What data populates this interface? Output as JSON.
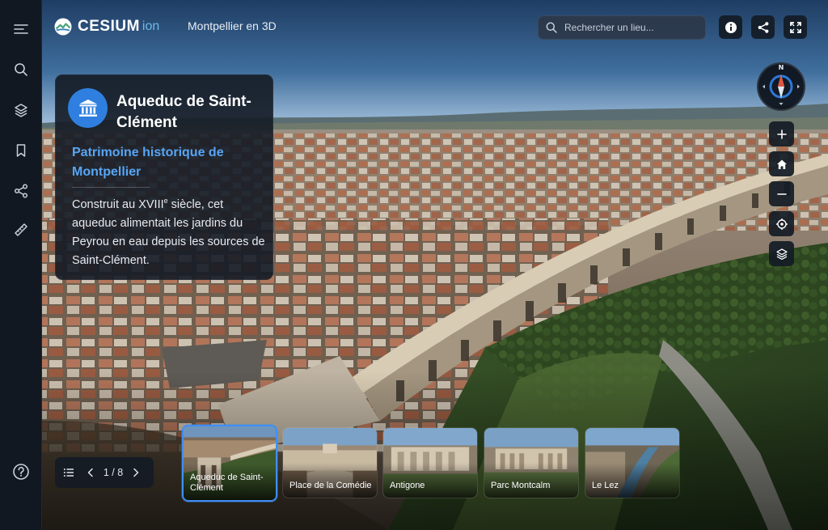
{
  "app": {
    "brand": "CESIUM",
    "brand_suffix": "ion",
    "title": "Montpellier en 3D"
  },
  "search": {
    "placeholder": "Rechercher un lieu..."
  },
  "toolbar": {
    "buttons": [
      {
        "icon": "info-icon"
      },
      {
        "icon": "share-icon"
      },
      {
        "icon": "fullscreen-icon"
      }
    ]
  },
  "sidebar": {
    "items": [
      {
        "icon": "menu-icon"
      },
      {
        "icon": "search-icon"
      },
      {
        "icon": "layers-icon"
      },
      {
        "icon": "bookmark-icon"
      },
      {
        "icon": "share-icon"
      },
      {
        "icon": "ruler-icon"
      }
    ],
    "help_icon": "help-icon"
  },
  "compass": {
    "north": "N"
  },
  "nav": {
    "buttons": [
      {
        "icon": "zoom-in-icon"
      },
      {
        "icon": "home-icon"
      },
      {
        "icon": "zoom-out-icon"
      },
      {
        "icon": "locate-icon"
      },
      {
        "icon": "layers-icon"
      }
    ]
  },
  "card": {
    "icon": "monument-icon",
    "accent_color": "#2f7fe0",
    "title": "Aqueduc de Saint-Clément",
    "subtitle": "Patrimoine historique de Montpellier",
    "desc_before": "Construit au XVIII",
    "desc_sup": "e",
    "desc_after": " siècle, cet aqueduc alimentait les jardins du Peyrou en eau depuis les sources de Saint-Clément."
  },
  "pager": {
    "count": "1 / 8"
  },
  "places": [
    {
      "label": "Aqueduc de Saint-Clément",
      "active": true
    },
    {
      "label": "Place de la Comédie",
      "active": false
    },
    {
      "label": "Antigone",
      "active": false
    },
    {
      "label": "Parc Montcalm",
      "active": false
    },
    {
      "label": "Le Lez",
      "active": false
    }
  ],
  "colors": {
    "accent": "#3e8ff5",
    "panel": "#141b25",
    "rail": "#121821"
  }
}
